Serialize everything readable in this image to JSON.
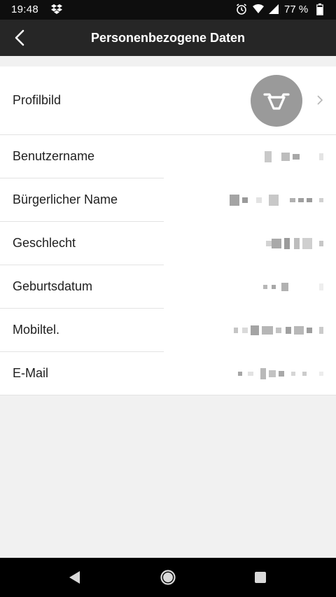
{
  "status_bar": {
    "time": "19:48",
    "battery_percent": "77 %",
    "icons": [
      "dropbox-icon",
      "alarm-icon",
      "wifi-icon",
      "signal-icon",
      "battery-icon"
    ]
  },
  "app_bar": {
    "title": "Personenbezogene Daten",
    "back_icon": "back-arrow-icon"
  },
  "profile": {
    "label": "Profilbild",
    "avatar_icon": "bull-head-icon",
    "avatar_color": "#9a9a9a"
  },
  "fields": [
    {
      "label": "Benutzername",
      "value": "[verpixelt]"
    },
    {
      "label": "Bürgerlicher Name",
      "value": "[verpixelt]"
    },
    {
      "label": "Geschlecht",
      "value": "[verpixelt]"
    },
    {
      "label": "Geburtsdatum",
      "value": "[verpixelt]"
    },
    {
      "label": "Mobiltel.",
      "value": "[verpixelt]"
    },
    {
      "label": "E-Mail",
      "value": "[verpixelt]"
    }
  ],
  "nav_bar": {
    "buttons": [
      "nav-back-icon",
      "nav-home-icon",
      "nav-recents-icon"
    ]
  },
  "colors": {
    "status_bar": "#0e0e0e",
    "app_bar": "#262626",
    "background": "#f1f1f1",
    "row": "#ffffff",
    "divider": "#e3e3e3"
  }
}
